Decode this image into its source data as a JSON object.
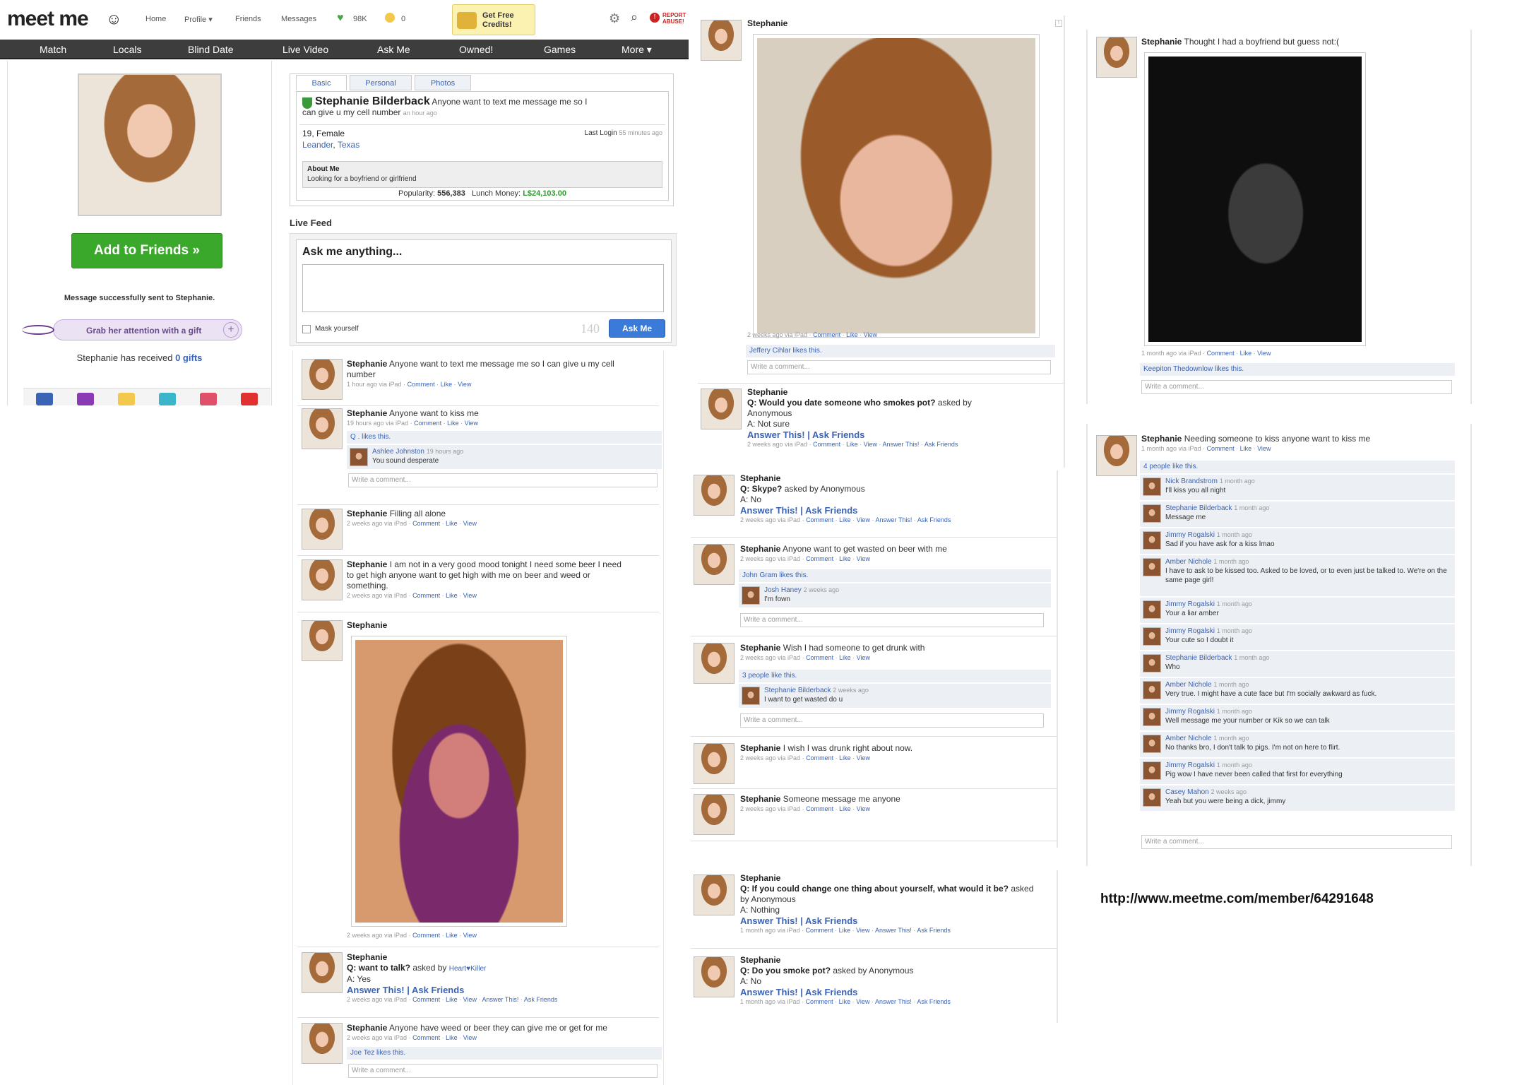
{
  "header": {
    "logo": "meet me",
    "nav": [
      "Home",
      "Profile ▾",
      "Friends",
      "Messages"
    ],
    "points": "98K",
    "coins": "0",
    "credits": "Get Free Credits!",
    "report": "REPORT ABUSE!",
    "menu": [
      "Match",
      "Locals",
      "Blind Date",
      "Live Video",
      "Ask Me",
      "Owned!",
      "Games",
      "More ▾"
    ]
  },
  "left": {
    "add_friends": "Add to Friends »",
    "msg_sent": "Message successfully sent to Stephanie.",
    "gift_btn": "Grab her attention with a gift",
    "gifts_prefix": "Stephanie has received ",
    "gifts_count": "0 gifts"
  },
  "profile": {
    "tabs": [
      "Basic",
      "Personal",
      "Photos"
    ],
    "name": "Stephanie Bilderback",
    "status": "Anyone want to text me message me so I can give u my cell number",
    "status_time": "an hour ago",
    "age_sex": "19, Female",
    "city": "Leander",
    "state": "Texas",
    "last_login_label": "Last Login",
    "last_login": "55 minutes ago",
    "about_label": "About Me",
    "about": "Looking for a boyfriend or girlfriend",
    "popularity_label": "Popularity:",
    "popularity": "556,383",
    "lunch_label": "Lunch Money:",
    "lunch": "L$24,103.00"
  },
  "live_feed": {
    "title": "Live Feed",
    "ask_title": "Ask me anything...",
    "mask": "Mask yourself",
    "char_count": "140",
    "ask_btn": "Ask Me"
  },
  "meta_links": {
    "comment": "Comment",
    "like": "Like",
    "view": "View",
    "answer_this": "Answer This!",
    "ask_friends": "Ask Friends",
    "write": "Write a comment...",
    "answer_pair": "Answer This! | Ask Friends"
  },
  "col1": [
    {
      "name": "Stephanie",
      "text": "Anyone want to text me message me so I can give u my cell number",
      "time": "1 hour ago via iPad"
    },
    {
      "name": "Stephanie",
      "text": "Anyone want to kiss me",
      "time": "19 hours ago via iPad",
      "likes": "Q . likes this.",
      "c_name": "Ashlee Johnston",
      "c_time": "19 hours ago",
      "c_text": "You sound desperate"
    },
    {
      "name": "Stephanie",
      "text": "Filling all alone",
      "time": "2 weeks ago via iPad"
    },
    {
      "name": "Stephanie",
      "text": "I am not in a very good mood tonight I need some beer I need to get high anyone want to get high with me on beer and weed or something.",
      "time": "2 weeks ago via iPad"
    },
    {
      "name": "Stephanie",
      "text": "",
      "time": "2 weeks ago via iPad"
    },
    {
      "name": "Stephanie",
      "q": "Q: want to talk?",
      "asked": "asked by",
      "asker": "Heart♥Killer",
      "a": "A: Yes",
      "time": "2 weeks ago via iPad"
    },
    {
      "name": "Stephanie",
      "text": "Anyone have weed or beer they can give me or get for me",
      "time": "2 weeks ago via iPad",
      "likes": "Joe Tez likes this."
    }
  ],
  "col2": [
    {
      "name": "Stephanie",
      "time": "2 weeks ago via iPad",
      "likes": "Jeffery Cihlar likes this."
    },
    {
      "name": "Stephanie",
      "q": "Q: Would you date someone who smokes pot?",
      "asked": "asked by Anonymous",
      "a": "A: Not sure",
      "time": "2 weeks ago via iPad"
    },
    {
      "name": "Stephanie",
      "q": "Q: Skype?",
      "asked": "asked by Anonymous",
      "a": "A: No",
      "time": "2 weeks ago via iPad"
    },
    {
      "name": "Stephanie",
      "text": "Anyone want to get wasted on beer with me",
      "time": "2 weeks ago via iPad",
      "likes": "John Gram likes this.",
      "c_name": "Josh Haney",
      "c_time": "2 weeks ago",
      "c_text": "I'm fown"
    },
    {
      "name": "Stephanie",
      "text": "Wish I had someone to get drunk with",
      "time": "2 weeks ago via iPad",
      "likes": "3 people like this.",
      "c_name": "Stephanie Bilderback",
      "c_time": "2 weeks ago",
      "c_text": "I want to get wasted do u"
    },
    {
      "name": "Stephanie",
      "text": "I wish I was drunk right about now.",
      "time": "2 weeks ago via iPad"
    },
    {
      "name": "Stephanie",
      "text": "Someone message me anyone",
      "time": "2 weeks ago via iPad"
    },
    {
      "name": "Stephanie",
      "q": "Q: If you could change one thing about yourself, what would it be?",
      "asked": "asked by Anonymous",
      "a": "A: Nothing",
      "time": "1 month ago via iPad"
    },
    {
      "name": "Stephanie",
      "q": "Q: Do you smoke pot?",
      "asked": "asked by Anonymous",
      "a": "A: No",
      "time": "1 month ago via iPad"
    }
  ],
  "col3": {
    "post1": {
      "name": "Stephanie",
      "text": "Thought I had a boyfriend but guess not:(",
      "time": "1 month ago via iPad",
      "likes": "Keepiton Thedownlow likes this."
    },
    "post2": {
      "name": "Stephanie",
      "text": "Needing someone to kiss anyone want to kiss me",
      "time": "1 month ago via iPad",
      "likes": "4 people like this."
    },
    "comments": [
      {
        "name": "Nick Brandstrom",
        "time": "1 month ago",
        "text": "I'll kiss you all night"
      },
      {
        "name": "Stephanie Bilderback",
        "time": "1 month ago",
        "text": "Message me"
      },
      {
        "name": "Jimmy Rogalski",
        "time": "1 month ago",
        "text": "Sad if you have ask for a kiss lmao"
      },
      {
        "name": "Amber Nichole",
        "time": "1 month ago",
        "text": "I have to ask to be kissed too. Asked to be loved, or to even just be talked to. We're on the same page girl!"
      },
      {
        "name": "Jimmy Rogalski",
        "time": "1 month ago",
        "text": "Your a liar amber"
      },
      {
        "name": "Jimmy Rogalski",
        "time": "1 month ago",
        "text": "Your cute so I doubt it"
      },
      {
        "name": "Stephanie Bilderback",
        "time": "1 month ago",
        "text": "Who"
      },
      {
        "name": "Amber Nichole",
        "time": "1 month ago",
        "text": "Very true. I might have a cute face but I'm socially awkward as fuck."
      },
      {
        "name": "Jimmy Rogalski",
        "time": "1 month ago",
        "text": "Well message me your number or Kik so we can talk"
      },
      {
        "name": "Amber Nichole",
        "time": "1 month ago",
        "text": "No thanks bro, I don't talk to pigs. I'm not on here to flirt."
      },
      {
        "name": "Jimmy Rogalski",
        "time": "1 month ago",
        "text": "Pig wow I have never been called that first for everything"
      },
      {
        "name": "Casey Mahon",
        "time": "2 weeks ago",
        "text": "Yeah but you were being a dick, jimmy"
      }
    ],
    "url": "http://www.meetme.com/member/64291648"
  }
}
